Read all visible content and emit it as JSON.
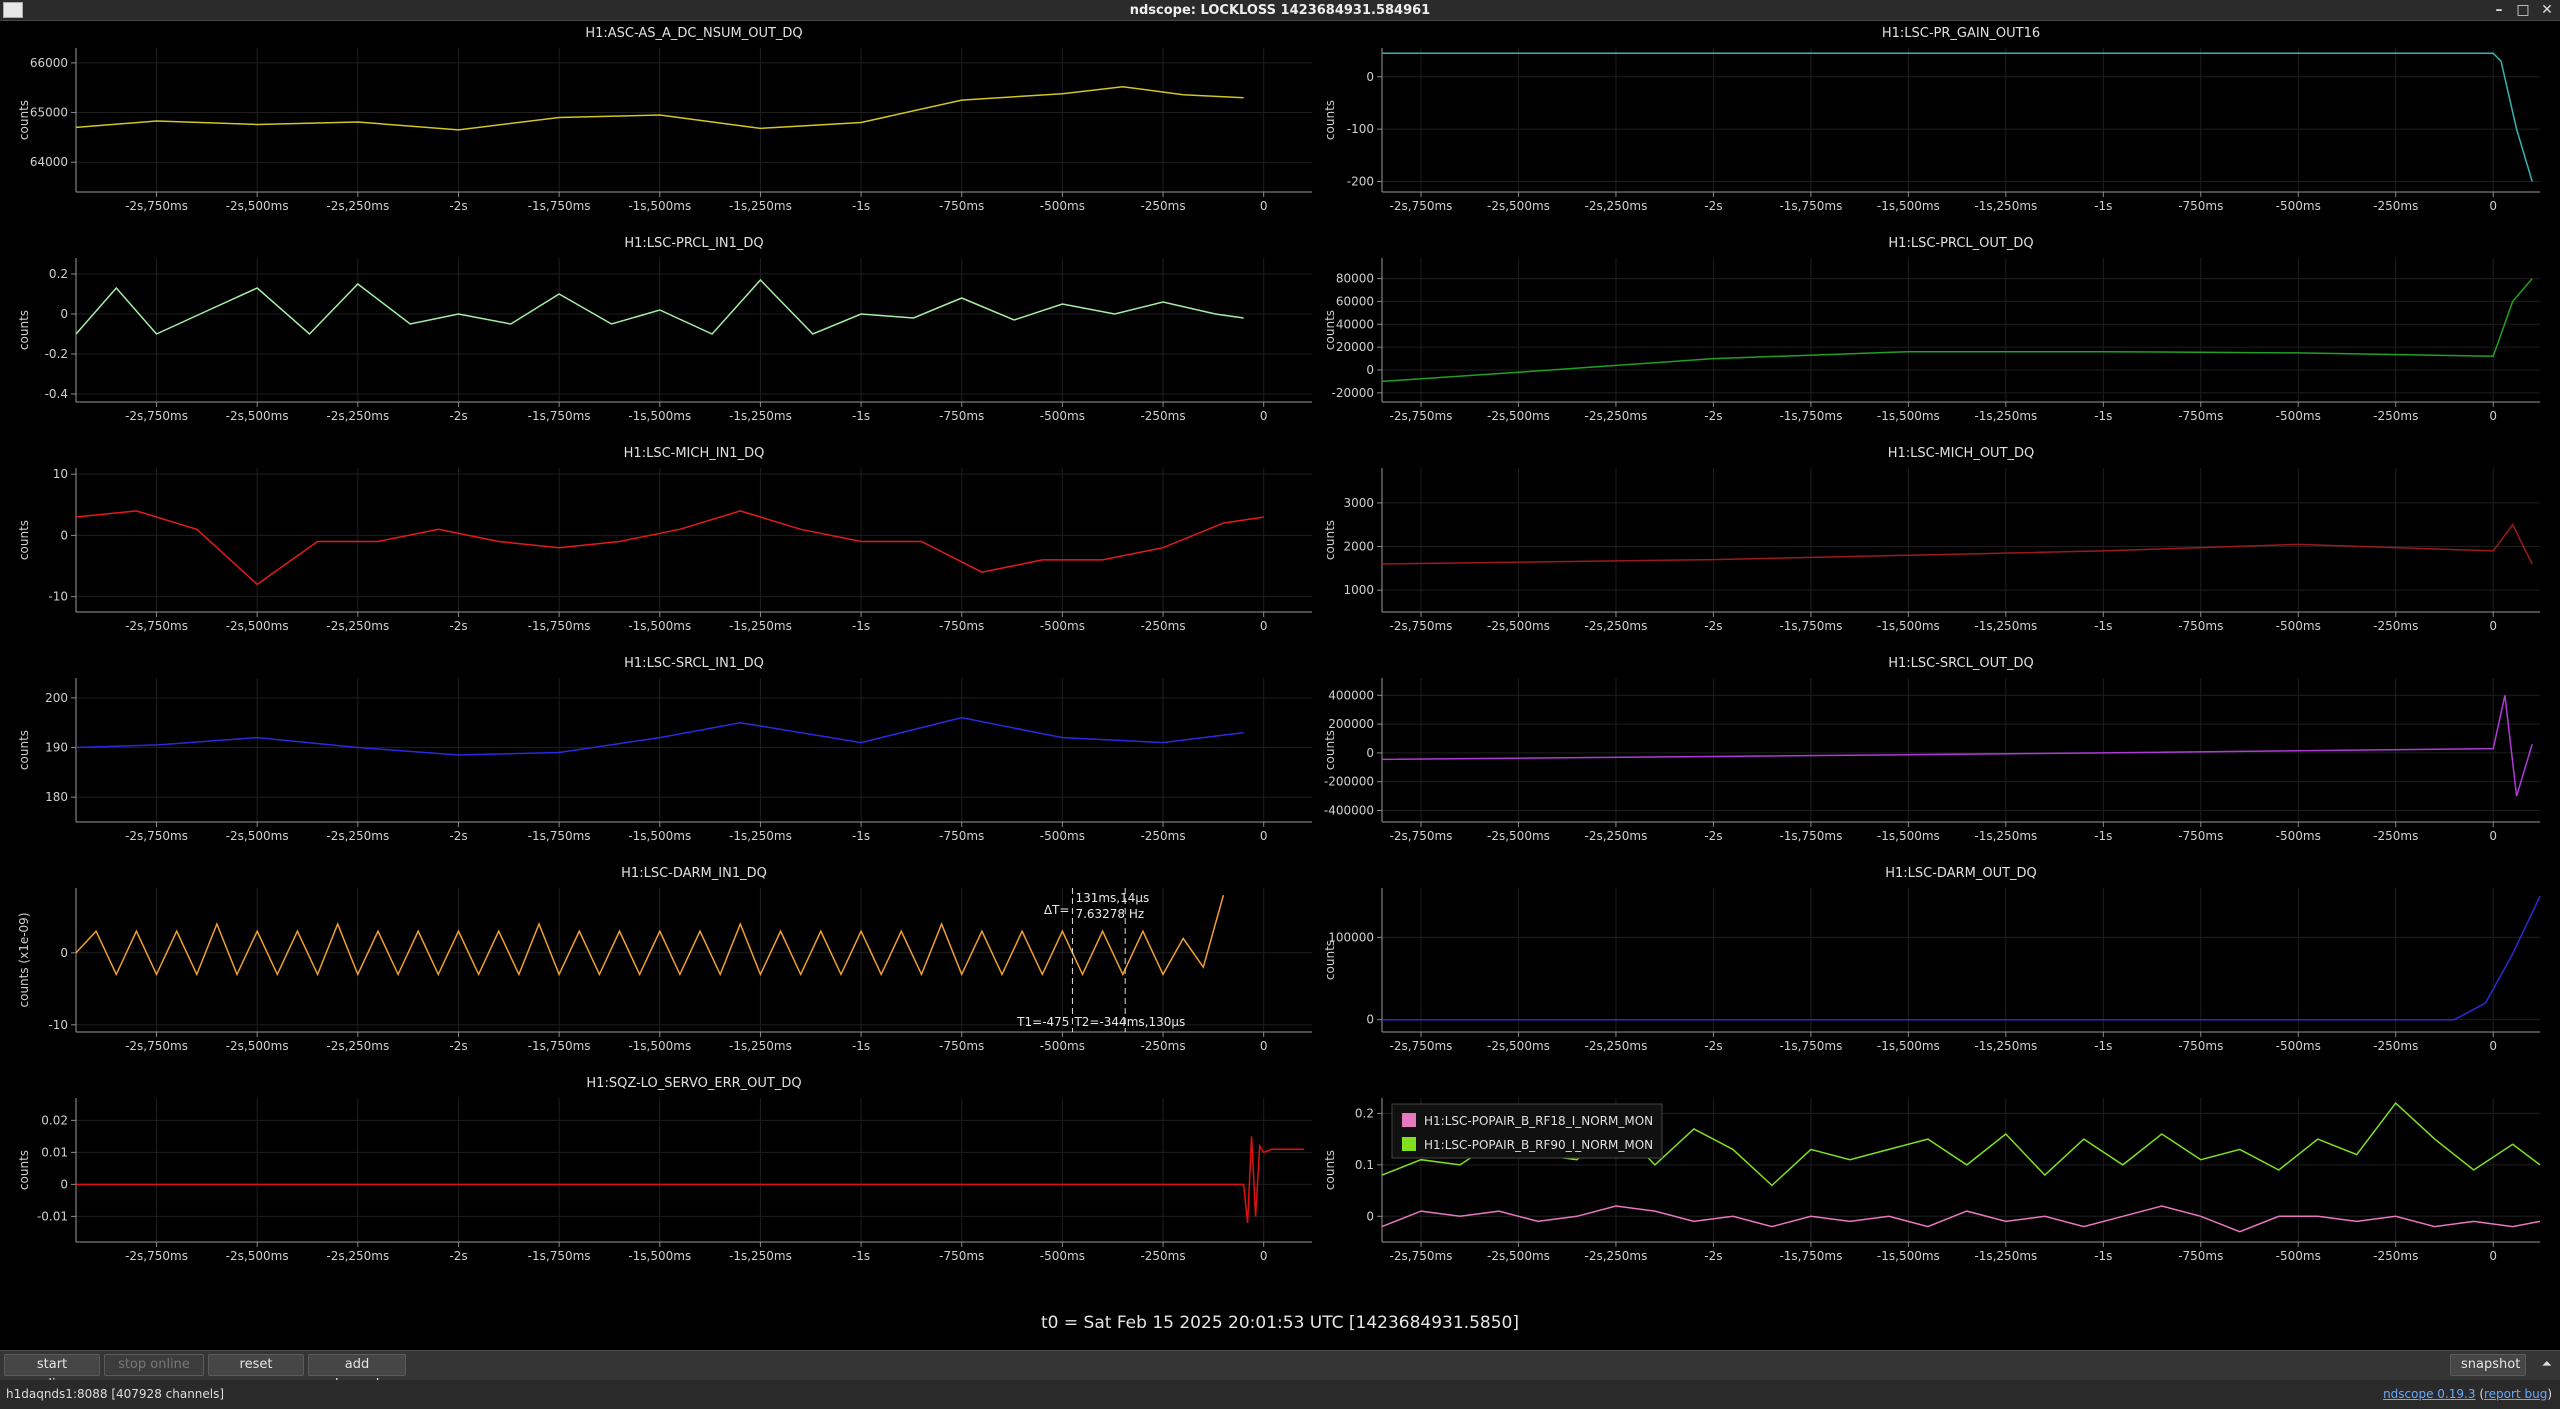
{
  "window": {
    "title": "ndscope: LOCKLOSS 1423684931.584961",
    "minimize_icon": "minimize-icon",
    "maximize_icon": "maximize-icon",
    "close_icon": "close-icon"
  },
  "footer": {
    "t0": "t0 = Sat Feb 15 2025 20:01:53 UTC [1423684931.5850]"
  },
  "toolbar": {
    "start_online": "start online",
    "stop_online": "stop online",
    "reset": "reset",
    "add_channels": "add channels",
    "snapshot": "snapshot",
    "collapse_glyph": "⏶"
  },
  "status": {
    "server": "h1daqnds1:8088  [407928 channels]",
    "version_link": "ndscope 0.19.3",
    "report_link": "report bug",
    "report_open": "(",
    "report_close": ")"
  },
  "common": {
    "x_tick_labels": [
      "-2s,750ms",
      "-2s,500ms",
      "-2s,250ms",
      "-2s",
      "-1s,750ms",
      "-1s,500ms",
      "-1s,250ms",
      "-1s",
      "-750ms",
      "-500ms",
      "-250ms",
      "0"
    ]
  },
  "cursor": {
    "dt_label": "ΔT=",
    "dt_value": "131ms,14µs",
    "freq_value": "7.63278 Hz",
    "t1_label": "T1=-475",
    "t2_label": "T2=-344ms,130µs"
  },
  "chart_data": [
    {
      "type": "line",
      "title": "H1:ASC-AS_A_DC_NSUM_OUT_DQ",
      "ylabel": "counts",
      "color": "#d2c524",
      "ylim": [
        63400,
        66300
      ],
      "yticks": [
        64000,
        65000,
        66000
      ],
      "ytick_labels": [
        "64000",
        "65000",
        "66000"
      ],
      "xlim": [
        -2.95,
        0.12
      ],
      "x": [
        -2.95,
        -2.75,
        -2.5,
        -2.25,
        -2.0,
        -1.75,
        -1.5,
        -1.25,
        -1.0,
        -0.75,
        -0.5,
        -0.35,
        -0.2,
        -0.05
      ],
      "y": [
        64700,
        64830,
        64760,
        64810,
        64650,
        64900,
        64950,
        64680,
        64800,
        65250,
        65380,
        65520,
        65360,
        65300
      ]
    },
    {
      "type": "line",
      "title": "H1:LSC-PR_GAIN_OUT16",
      "ylabel": "counts",
      "color": "#35b4b4",
      "ylim": [
        -220,
        55
      ],
      "yticks": [
        -200,
        -100,
        0
      ],
      "ytick_labels": [
        "-200",
        "-100",
        "0"
      ],
      "xlim": [
        -2.85,
        0.12
      ],
      "x": [
        -2.85,
        -2.0,
        -1.0,
        -0.5,
        0.0,
        0.02,
        0.06,
        0.1
      ],
      "y": [
        45,
        45,
        45,
        45,
        45,
        30,
        -100,
        -200
      ]
    },
    {
      "type": "line",
      "title": "H1:LSC-PRCL_IN1_DQ",
      "ylabel": "counts",
      "color": "#a6eea6",
      "ylim": [
        -0.44,
        0.28
      ],
      "yticks": [
        -0.4,
        -0.2,
        0,
        0.2
      ],
      "ytick_labels": [
        "-0.4",
        "-0.2",
        "0",
        "0.2"
      ],
      "xlim": [
        -2.95,
        0.12
      ],
      "x": [
        -2.95,
        -2.85,
        -2.75,
        -2.62,
        -2.5,
        -2.37,
        -2.25,
        -2.12,
        -2.0,
        -1.87,
        -1.75,
        -1.62,
        -1.5,
        -1.37,
        -1.25,
        -1.12,
        -1.0,
        -0.87,
        -0.75,
        -0.62,
        -0.5,
        -0.37,
        -0.25,
        -0.12,
        -0.05
      ],
      "y": [
        -0.1,
        0.13,
        -0.1,
        0.02,
        0.13,
        -0.1,
        0.15,
        -0.05,
        0.0,
        -0.05,
        0.1,
        -0.05,
        0.02,
        -0.1,
        0.17,
        -0.1,
        0.0,
        -0.02,
        0.08,
        -0.03,
        0.05,
        0.0,
        0.06,
        0.0,
        -0.02
      ]
    },
    {
      "type": "line",
      "title": "H1:LSC-PRCL_OUT_DQ",
      "ylabel": "counts",
      "color": "#22a022",
      "ylim": [
        -28000,
        98000
      ],
      "yticks": [
        -20000,
        0,
        20000,
        40000,
        60000,
        80000
      ],
      "ytick_labels": [
        "-20000",
        "0",
        "20000",
        "40000",
        "60000",
        "80000"
      ],
      "xlim": [
        -2.85,
        0.12
      ],
      "x": [
        -2.85,
        -2.5,
        -2.0,
        -1.5,
        -1.0,
        -0.5,
        0.0,
        0.05,
        0.1
      ],
      "y": [
        -10000,
        -2000,
        10000,
        16000,
        16000,
        15000,
        12000,
        60000,
        80000
      ]
    },
    {
      "type": "line",
      "title": "H1:LSC-MICH_IN1_DQ",
      "ylabel": "counts",
      "color": "#e31b1b",
      "ylim": [
        -12.5,
        11
      ],
      "yticks": [
        -10,
        0,
        10
      ],
      "ytick_labels": [
        "-10",
        "0",
        "10"
      ],
      "xlim": [
        -2.95,
        0.12
      ],
      "x": [
        -2.95,
        -2.8,
        -2.65,
        -2.5,
        -2.35,
        -2.2,
        -2.05,
        -1.9,
        -1.75,
        -1.6,
        -1.45,
        -1.3,
        -1.15,
        -1.0,
        -0.85,
        -0.7,
        -0.55,
        -0.4,
        -0.25,
        -0.1,
        0.0
      ],
      "y": [
        3,
        4,
        1,
        -8,
        -1,
        -1,
        1,
        -1,
        -2,
        -1,
        1,
        4,
        1,
        -1,
        -1,
        -6,
        -4,
        -4,
        -2,
        2,
        3
      ]
    },
    {
      "type": "line",
      "title": "H1:LSC-MICH_OUT_DQ",
      "ylabel": "counts",
      "color": "#9b1b1b",
      "ylim": [
        500,
        3800
      ],
      "yticks": [
        1000,
        2000,
        3000
      ],
      "ytick_labels": [
        "1000",
        "2000",
        "3000"
      ],
      "xlim": [
        -2.85,
        0.12
      ],
      "x": [
        -2.85,
        -2.0,
        -1.0,
        -0.5,
        0.0,
        0.05,
        0.1
      ],
      "y": [
        1600,
        1700,
        1900,
        2050,
        1900,
        2500,
        1600
      ]
    },
    {
      "type": "line",
      "title": "H1:LSC-SRCL_IN1_DQ",
      "ylabel": "counts",
      "color": "#2a2ae0",
      "ylim": [
        175,
        204
      ],
      "yticks": [
        180,
        190,
        200
      ],
      "ytick_labels": [
        "180",
        "190",
        "200"
      ],
      "xlim": [
        -2.95,
        0.12
      ],
      "x": [
        -2.95,
        -2.75,
        -2.5,
        -2.25,
        -2.0,
        -1.75,
        -1.5,
        -1.3,
        -1.0,
        -0.75,
        -0.5,
        -0.25,
        -0.05
      ],
      "y": [
        190,
        190.5,
        192,
        190,
        188.5,
        189,
        192,
        195,
        191,
        196,
        192,
        191,
        193
      ]
    },
    {
      "type": "line",
      "title": "H1:LSC-SRCL_OUT_DQ",
      "ylabel": "counts",
      "color": "#b03ad8",
      "ylim": [
        -480000,
        520000
      ],
      "yticks": [
        -400000,
        -200000,
        0,
        200000,
        400000
      ],
      "ytick_labels": [
        "-400000",
        "-200000",
        "0",
        "200000",
        "400000"
      ],
      "xlim": [
        -2.85,
        0.12
      ],
      "x": [
        -2.85,
        -2.0,
        -1.0,
        0.0,
        0.03,
        0.06,
        0.1
      ],
      "y": [
        -45000,
        -25000,
        0,
        30000,
        400000,
        -300000,
        60000
      ]
    },
    {
      "type": "line",
      "title": "H1:LSC-DARM_IN1_DQ",
      "ylabel": "counts (x1e-09)",
      "color": "#f0a030",
      "ylim": [
        -11,
        9
      ],
      "yticks": [
        -10,
        0
      ],
      "ytick_labels": [
        "-10",
        "0"
      ],
      "xlim": [
        -2.95,
        0.12
      ],
      "x": [
        -2.95,
        -2.9,
        -2.85,
        -2.8,
        -2.75,
        -2.7,
        -2.65,
        -2.6,
        -2.55,
        -2.5,
        -2.45,
        -2.4,
        -2.35,
        -2.3,
        -2.25,
        -2.2,
        -2.15,
        -2.1,
        -2.05,
        -2.0,
        -1.95,
        -1.9,
        -1.85,
        -1.8,
        -1.75,
        -1.7,
        -1.65,
        -1.6,
        -1.55,
        -1.5,
        -1.45,
        -1.4,
        -1.35,
        -1.3,
        -1.25,
        -1.2,
        -1.15,
        -1.1,
        -1.05,
        -1.0,
        -0.95,
        -0.9,
        -0.85,
        -0.8,
        -0.75,
        -0.7,
        -0.65,
        -0.6,
        -0.55,
        -0.5,
        -0.45,
        -0.4,
        -0.35,
        -0.3,
        -0.25,
        -0.2,
        -0.15,
        -0.1
      ],
      "y": [
        0,
        3,
        -3,
        3,
        -3,
        3,
        -3,
        4,
        -3,
        3,
        -3,
        3,
        -3,
        4,
        -3,
        3,
        -3,
        3,
        -3,
        3,
        -3,
        3,
        -3,
        4,
        -3,
        3,
        -3,
        3,
        -3,
        3,
        -3,
        3,
        -3,
        4,
        -3,
        3,
        -3,
        3,
        -3,
        3,
        -3,
        3,
        -3,
        4,
        -3,
        3,
        -3,
        3,
        -3,
        3,
        -3,
        3,
        -3,
        3,
        -3,
        2,
        -2,
        8
      ]
    },
    {
      "type": "line",
      "title": "H1:LSC-DARM_OUT_DQ",
      "ylabel": "counts",
      "color": "#2a2ad8",
      "ylim": [
        -15000,
        160000
      ],
      "yticks": [
        0,
        100000
      ],
      "ytick_labels": [
        "0",
        "100000"
      ],
      "xlim": [
        -2.85,
        0.12
      ],
      "x": [
        -2.85,
        -2.0,
        -1.0,
        -0.1,
        -0.02,
        0.05,
        0.12
      ],
      "y": [
        0,
        0,
        0,
        0,
        20000,
        80000,
        150000
      ]
    },
    {
      "type": "line",
      "title": "H1:SQZ-LO_SERVO_ERR_OUT_DQ",
      "ylabel": "counts",
      "color": "#e01010",
      "ylim": [
        -0.018,
        0.027
      ],
      "yticks": [
        -0.01,
        0,
        0.01,
        0.02
      ],
      "ytick_labels": [
        "-0.01",
        "0",
        "0.01",
        "0.02"
      ],
      "xlim": [
        -2.95,
        0.12
      ],
      "x": [
        -2.95,
        -0.05,
        -0.04,
        -0.03,
        -0.02,
        -0.01,
        0.0,
        0.02,
        0.05,
        0.1
      ],
      "y": [
        0,
        0,
        -0.012,
        0.015,
        -0.01,
        0.012,
        0.01,
        0.011,
        0.011,
        0.011
      ]
    },
    {
      "type": "line",
      "title": "",
      "ylabel": "counts",
      "ylim": [
        -0.05,
        0.23
      ],
      "yticks": [
        0,
        0.1,
        0.2
      ],
      "ytick_labels": [
        "0",
        "0.1",
        "0.2"
      ],
      "xlim": [
        -2.85,
        0.12
      ],
      "x": [
        -2.85,
        -2.75,
        -2.65,
        -2.55,
        -2.45,
        -2.35,
        -2.25,
        -2.15,
        -2.05,
        -1.95,
        -1.85,
        -1.75,
        -1.65,
        -1.55,
        -1.45,
        -1.35,
        -1.25,
        -1.15,
        -1.05,
        -0.95,
        -0.85,
        -0.75,
        -0.65,
        -0.55,
        -0.45,
        -0.35,
        -0.25,
        -0.15,
        -0.05,
        0.05,
        0.12
      ],
      "legend_position": "top-left",
      "series": [
        {
          "name": "H1:LSC-POPAIR_B_RF18_I_NORM_MON",
          "color": "#e878c0",
          "values": [
            -0.02,
            0.01,
            0.0,
            0.01,
            -0.01,
            0.0,
            0.02,
            0.01,
            -0.01,
            0.0,
            -0.02,
            0.0,
            -0.01,
            0.0,
            -0.02,
            0.01,
            -0.01,
            0.0,
            -0.02,
            0.0,
            0.02,
            0.0,
            -0.03,
            0.0,
            0.0,
            -0.01,
            0.0,
            -0.02,
            -0.01,
            -0.02,
            -0.01
          ]
        },
        {
          "name": "H1:LSC-POPAIR_B_RF90_I_NORM_MON",
          "color": "#80e020",
          "values": [
            0.08,
            0.11,
            0.1,
            0.15,
            0.12,
            0.11,
            0.18,
            0.1,
            0.17,
            0.13,
            0.06,
            0.13,
            0.11,
            0.13,
            0.15,
            0.1,
            0.16,
            0.08,
            0.15,
            0.1,
            0.16,
            0.11,
            0.13,
            0.09,
            0.15,
            0.12,
            0.22,
            0.15,
            0.09,
            0.14,
            0.1
          ]
        }
      ]
    }
  ]
}
